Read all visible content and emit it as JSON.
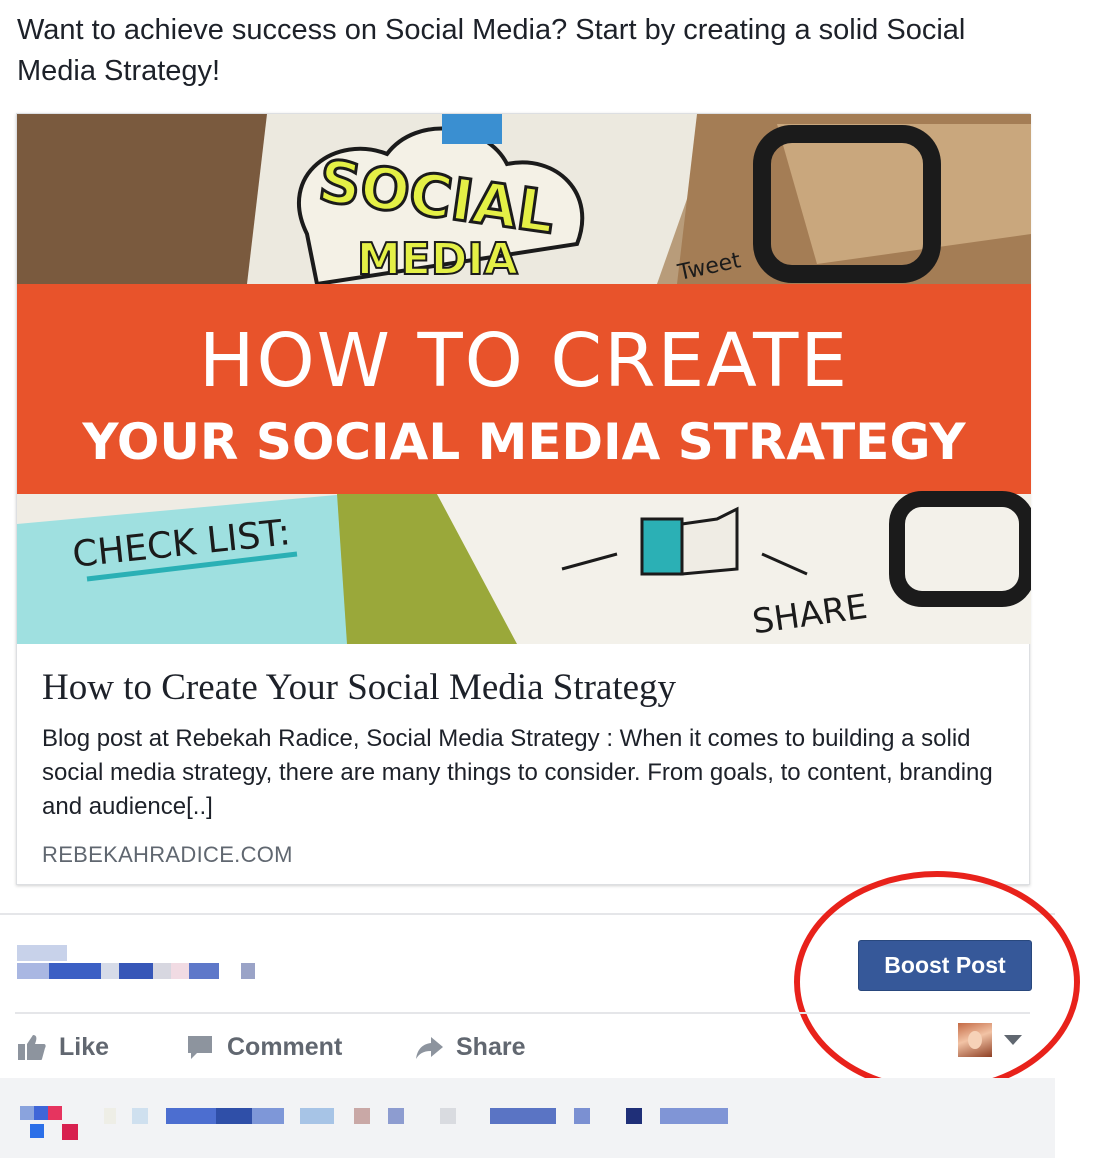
{
  "post": {
    "message": "Want to achieve success on Social Media? Start by creating a solid Social Media Strategy!"
  },
  "link_card": {
    "image": {
      "banner_line1": "HOW TO CREATE",
      "banner_line2": "YOUR SOCIAL MEDIA STRATEGY",
      "doodle_social": "SOCIAL",
      "doodle_media": "MEDIA",
      "doodle_checklist": "CHECK LIST:",
      "doodle_share": "SHARE",
      "doodle_tweet": "Tweet"
    },
    "title": "How to Create Your Social Media Strategy",
    "description": "Blog post at Rebekah Radice, Social Media Strategy : When it comes to building a solid social media strategy, there are many things to consider. From goals, to content, branding and audience[..]",
    "domain": "REBEKAHRADICE.COM"
  },
  "boost": {
    "label": "Boost Post"
  },
  "actions": {
    "like": "Like",
    "comment": "Comment",
    "share": "Share"
  },
  "colors": {
    "boost_button": "#365899",
    "banner_orange": "#e8532b",
    "highlight_ring": "#e8221b",
    "action_text": "#616770"
  },
  "icons": {
    "like": "thumbs-up-icon",
    "comment": "speech-bubble-icon",
    "share": "share-arrow-icon",
    "audience": "chevron-down-icon"
  }
}
